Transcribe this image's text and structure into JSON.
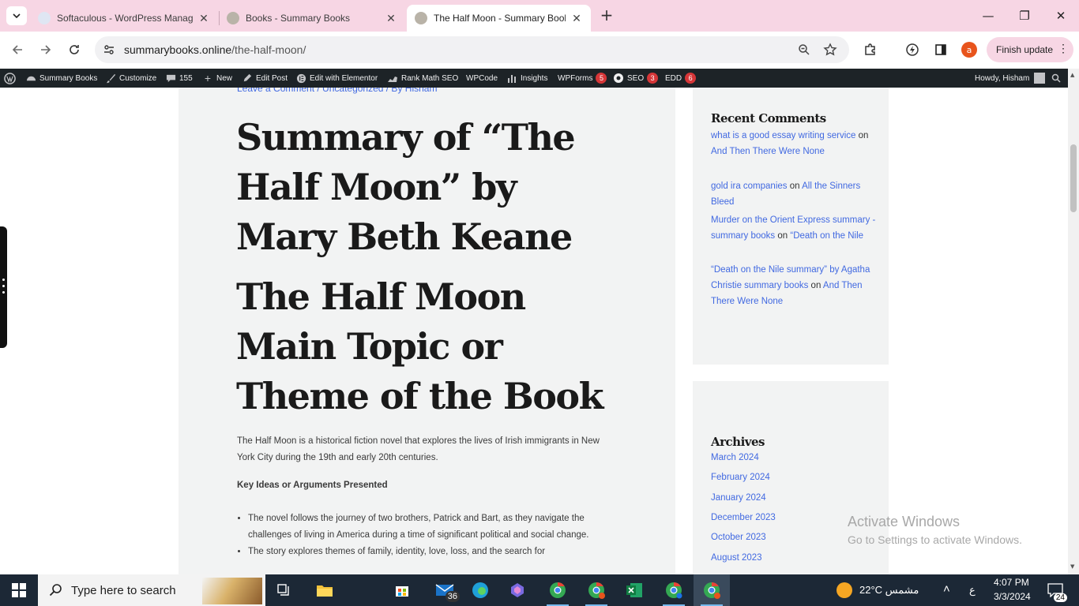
{
  "browser": {
    "tabs": [
      {
        "title": "Softaculous - WordPress Manag",
        "active": false
      },
      {
        "title": "Books - Summary Books",
        "active": false
      },
      {
        "title": "The Half Moon - Summary Book",
        "active": true
      }
    ],
    "url_domain": "summarybooks.online",
    "url_path": "/the-half-moon/",
    "profile_letter": "a",
    "finish_update": "Finish update",
    "accent": "#f7d6e4"
  },
  "adminbar": {
    "site": "Summary Books",
    "customize": "Customize",
    "comments": "155",
    "new": "New",
    "edit_post": "Edit Post",
    "elementor": "Edit with Elementor",
    "rank_math": "Rank Math SEO",
    "wpcode": "WPCode",
    "insights": "Insights",
    "wpforms": "WPForms",
    "wpforms_count": "5",
    "seo": "SEO",
    "seo_count": "3",
    "edd": "EDD",
    "edd_count": "6",
    "howdy": "Howdy, Hisham"
  },
  "article": {
    "meta": "Leave a Comment / Uncategorized / By Hisham",
    "title": "Summary of “The Half Moon” by Mary Beth Keane",
    "heading2": "The Half Moon Main Topic or Theme of the Book",
    "intro": "The Half Moon is a historical fiction novel that explores the lives of Irish immigrants in New York City during the 19th and early 20th centuries.",
    "key_heading": "Key Ideas or Arguments Presented",
    "bullets": [
      "The novel follows the journey of two brothers, Patrick and Bart, as they navigate the challenges of living in America during a time of significant political and social change.",
      "The story explores themes of family, identity, love, loss, and the search for"
    ]
  },
  "sidebar": {
    "recent_comments_title": "Recent Comments",
    "comments": [
      {
        "author": "what is a good essay writing service",
        "on": "on",
        "post": "And Then There Were None"
      },
      {
        "author": "gold ira companies",
        "on": "on",
        "post": "All the Sinners Bleed"
      },
      {
        "author": "Murder on the Orient Express summary - summary books",
        "on": "on",
        "post": "“Death on the Nile"
      },
      {
        "author": "“Death on the Nile summary” by Agatha Christie summary books",
        "on": "on",
        "post": "And Then There Were None"
      }
    ],
    "archives_title": "Archives",
    "archives": [
      "March 2024",
      "February 2024",
      "January 2024",
      "December 2023",
      "October 2023",
      "August 2023"
    ]
  },
  "watermark": {
    "line1": "Activate Windows",
    "line2": "Go to Settings to activate Windows."
  },
  "taskbar": {
    "search_placeholder": "Type here to search",
    "mail_badge": "36",
    "weather": "22°C  مشمس",
    "lang": "ع",
    "time": "4:07 PM",
    "date": "3/3/2024",
    "notifications": "24"
  }
}
